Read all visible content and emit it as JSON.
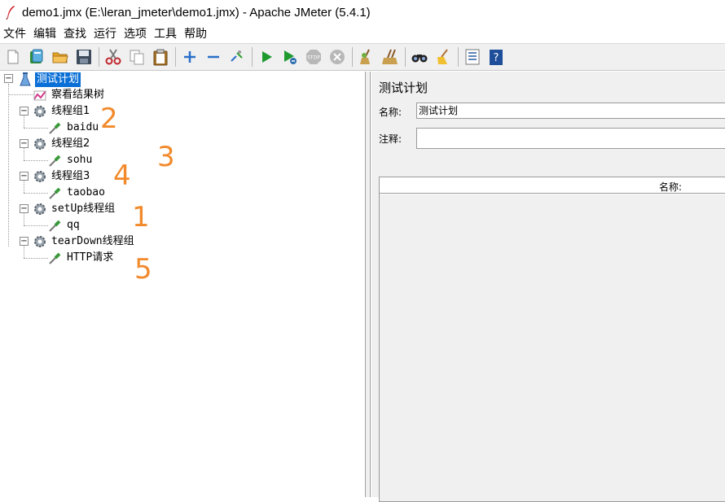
{
  "window": {
    "title": "demo1.jmx (E:\\leran_jmeter\\demo1.jmx) - Apache JMeter (5.4.1)"
  },
  "menu": [
    "文件",
    "编辑",
    "查找",
    "运行",
    "选项",
    "工具",
    "帮助"
  ],
  "toolbar": {
    "icons": [
      "new-icon",
      "templates-icon",
      "open-icon",
      "save-icon",
      "cut-icon",
      "copy-icon",
      "paste-icon",
      "expand-icon",
      "collapse-icon",
      "toggle-icon",
      "start-icon",
      "start-no-pause-icon",
      "stop-icon",
      "shutdown-icon",
      "clear-icon",
      "clear-all-icon",
      "search-icon",
      "reset-search-icon",
      "function-helper-icon",
      "help-icon"
    ]
  },
  "tree": {
    "root": "测试计划",
    "listener": "察看结果树",
    "group1": "线程组1",
    "sampler1": "baidu",
    "group2": "线程组2",
    "sampler2": "sohu",
    "group3": "线程组3",
    "sampler3": "taobao",
    "setup_group": "setUp线程组",
    "setup_sampler": "qq",
    "teardown_group": "tearDown线程组",
    "teardown_sampler": "HTTP请求"
  },
  "annotations": [
    "2",
    "3",
    "4",
    "1",
    "5"
  ],
  "panel": {
    "title": "测试计划",
    "name_label": "名称:",
    "name_value": "测试计划",
    "comment_label": "注释:",
    "comment_value": "",
    "table_column": "名称:"
  },
  "colors": {
    "selection": "#0a6fd6",
    "annotation": "#f28a2c"
  }
}
